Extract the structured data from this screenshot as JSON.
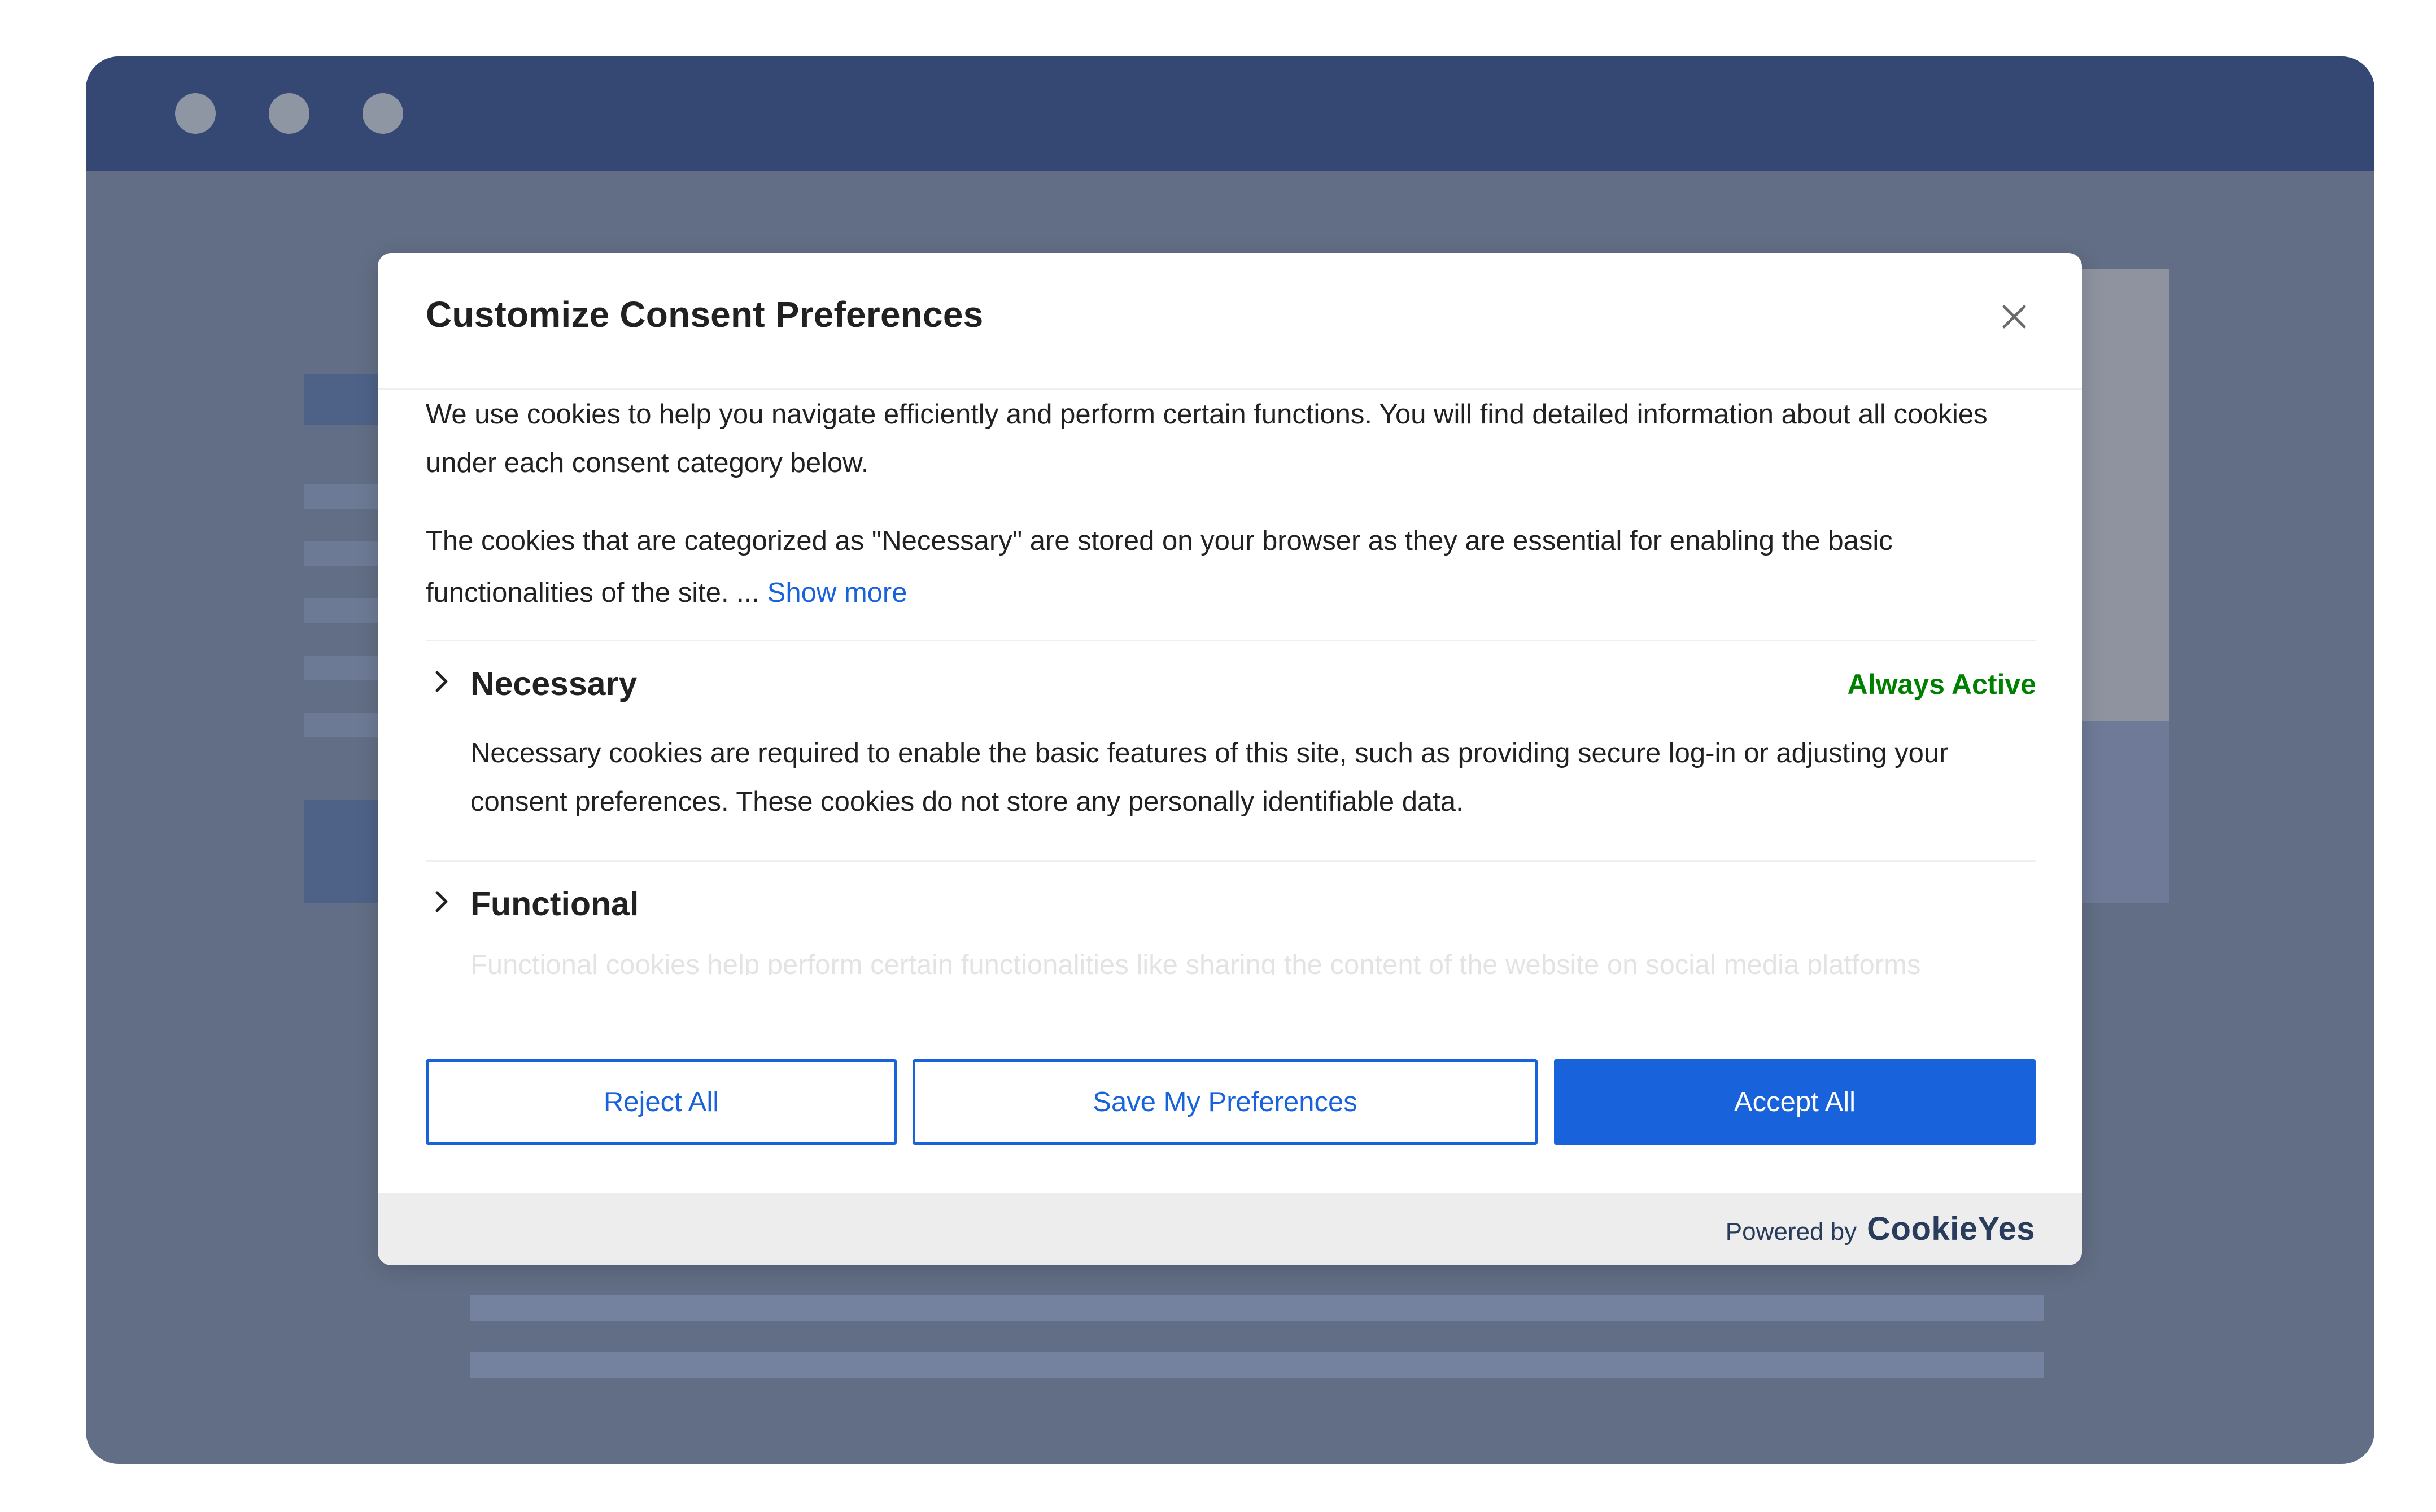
{
  "modal": {
    "title": "Customize Consent Preferences",
    "close_icon": "close-icon",
    "intro_paragraph": "We use cookies to help you navigate efficiently and perform certain functions. You will find detailed information about all cookies under each consent category below.",
    "necessary_paragraph": "The cookies that are categorized as \"Necessary\" are stored on your browser as they are essential for enabling the basic functionalities of the site. ...",
    "show_more": "Show more",
    "categories": [
      {
        "title": "Necessary",
        "status": "Always Active",
        "description": "Necessary cookies are required to enable the basic features of this site, such as providing secure log-in or adjusting your consent preferences. These cookies do not store any personally identifiable data."
      },
      {
        "title": "Functional",
        "description": "Functional cookies help perform certain functionalities like sharing the content of the website on social media platforms"
      }
    ],
    "buttons": {
      "reject": "Reject All",
      "save": "Save My Preferences",
      "accept": "Accept All"
    },
    "footer": {
      "powered_by": "Powered by",
      "brand": "CookieYes"
    }
  },
  "colors": {
    "accent": "#1863dc",
    "always_active": "#008000",
    "titlebar": "#344873",
    "page_bg": "#626e85"
  }
}
